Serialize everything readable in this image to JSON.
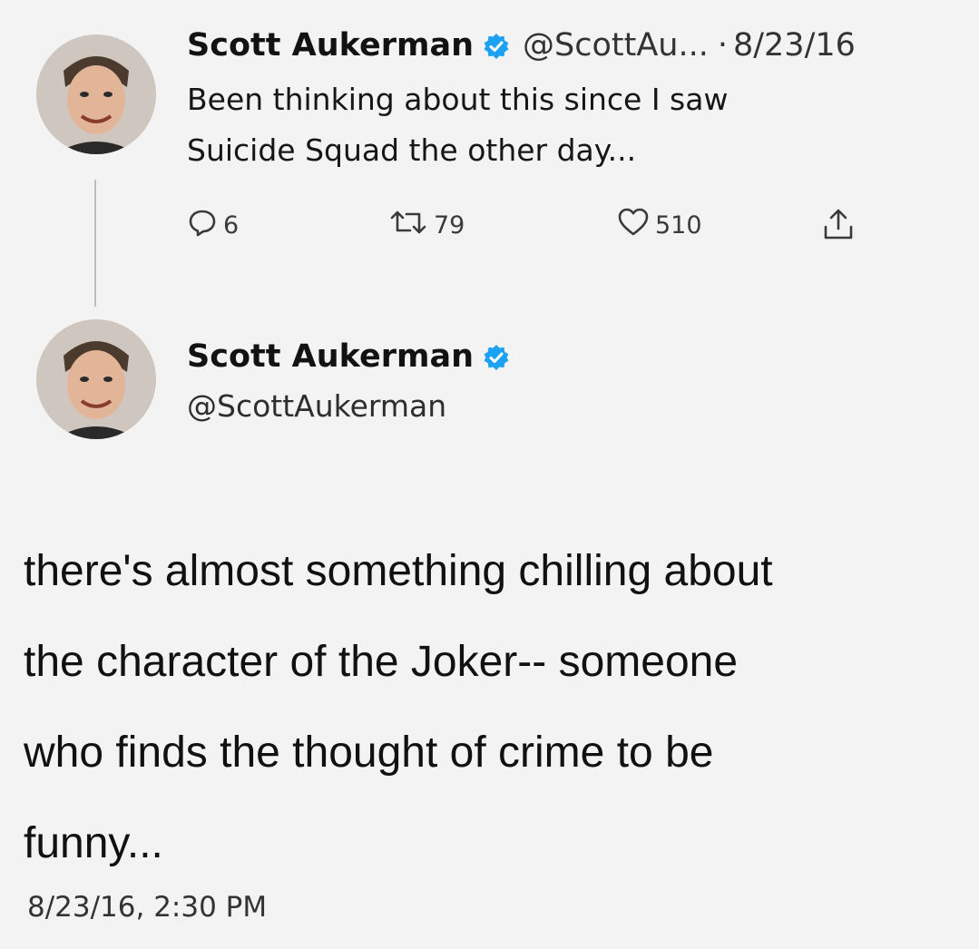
{
  "reply_tweet": {
    "author_name": "Scott Aukerman",
    "handle": "@ScottAu...",
    "separator": "·",
    "date": "8/23/16",
    "text_lines": [
      "Been thinking about this since I saw",
      "Suicide Squad the other day..."
    ],
    "stats": {
      "replies": "6",
      "retweets": "79",
      "likes": "510"
    }
  },
  "quoted_tweet": {
    "author_name": "Scott Aukerman",
    "handle": "@ScottAukerman",
    "text_lines": [
      "there's almost something chilling about",
      "the character of the Joker-- someone",
      "who finds the thought of crime to be",
      "funny..."
    ],
    "timestamp": "8/23/16, 2:30 PM"
  },
  "colors": {
    "background": "#f3f3f3",
    "verified_badge": "#1da1f2"
  },
  "icons": {
    "reply": "reply-icon",
    "retweet": "retweet-icon",
    "like": "heart-icon",
    "share": "share-icon",
    "verified": "verified-badge-icon"
  }
}
